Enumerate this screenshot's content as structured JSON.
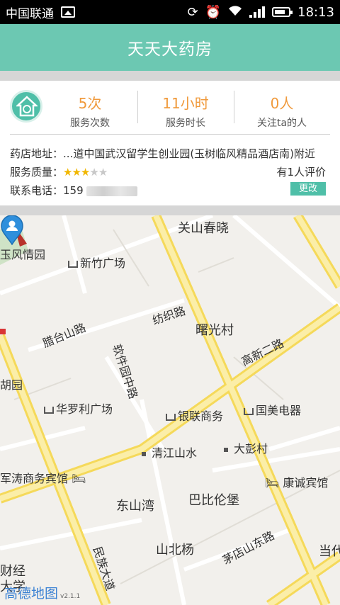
{
  "status_bar": {
    "carrier": "中国联通",
    "time": "18:13"
  },
  "header": {
    "title": "天天大药房"
  },
  "stats": [
    {
      "value": "5次",
      "label": "服务次数"
    },
    {
      "value": "11小时",
      "label": "服务时长"
    },
    {
      "value": "0人",
      "label": "关注ta的人"
    }
  ],
  "info": {
    "address_label": "药店地址：",
    "address_value": "...道中国武汉留学生创业园(玉树临风精品酒店南)附近",
    "quality_label": "服务质量：",
    "rating": 3,
    "rating_max": 5,
    "rating_count": "有1人评价",
    "phone_label": "联系电话：",
    "phone_value": "159",
    "change_button": "更改"
  },
  "map": {
    "labels": {
      "guanshan": "关山春晓",
      "fengqing": "玉风情园",
      "xinzhu": "新竹广场",
      "latai": "腊台山路",
      "fangzhi": "纺织路",
      "shuguang": "曙光村",
      "gaoxin": "高新二路",
      "ruanjian": "软件园中路",
      "huyuan": "胡园",
      "hualuoli": "华罗利广场",
      "yinlian": "银联商务",
      "guomei": "国美电器",
      "qingjiang": "清江山水",
      "dapeng": "大彭村",
      "juntao": "军涛商务宾馆",
      "kangcheng": "康诚宾馆",
      "dongshan": "东山湾",
      "babilun": "巴比伦堡",
      "shanbeiyang": "山北杨",
      "maodian": "茅店山东路",
      "minzu": "民族大道",
      "caijing": "财经",
      "daxue": "大学",
      "dangdai": "当代"
    },
    "watermark": "高德地图",
    "version": "v2.1.1"
  },
  "colors": {
    "accent": "#6cc8b2",
    "highlight": "#f09a3c",
    "star": "#f1b700",
    "road": "#f7e27a"
  }
}
